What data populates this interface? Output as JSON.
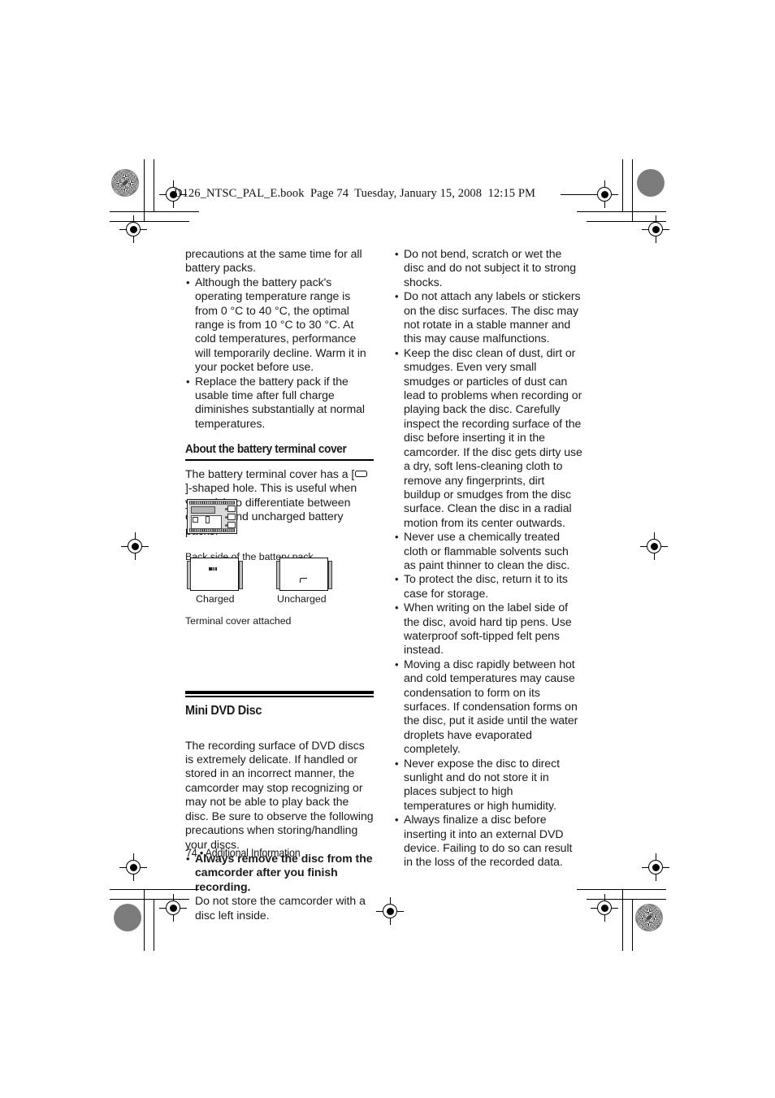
{
  "running_head": "D126_NTSC_PAL_E.book  Page 74  Tuesday, January 15, 2008  12:15 PM",
  "left_column": {
    "continued_paragraph": "precautions at the same time for all battery packs.",
    "battery_bullets": [
      "Although the battery pack's operating temperature range is from 0 °C to 40 °C, the optimal range is from 10 °C to 30 °C. At cold temperatures, performance will temporarily decline. Warm it in your pocket before use.",
      "Replace the battery pack if the usable time after full charge diminishes substantially at normal temperatures."
    ],
    "terminal_cover": {
      "heading": "About the battery terminal cover",
      "text_before_glyph": "The battery terminal cover has a [",
      "text_after_glyph": "]-shaped hole. This is useful when you wish to differentiate between charged and uncharged battery packs.",
      "caption_back_side": "Back side of the battery pack",
      "caption_terminal_cover": "Terminal cover attached",
      "label_charged": "Charged",
      "label_uncharged": "Uncharged"
    },
    "mini_dvd": {
      "heading": "Mini DVD Disc",
      "intro": "The recording surface of DVD discs is extremely delicate. If handled or stored in an incorrect manner, the camcorder may stop recognizing or may not be able to play back the disc. Be sure to observe the following precautions when storing/handling your discs.",
      "bullets": [
        {
          "lead": "Always remove the disc from the camcorder after you finish recording.",
          "sub": "Do not store the camcorder with a disc left inside."
        }
      ]
    }
  },
  "right_column": {
    "disc_bullets": [
      "Do not bend, scratch or wet the disc and do not subject it to strong shocks.",
      "Do not attach any labels or stickers on the disc surfaces. The disc may not rotate in a stable manner and this may cause malfunctions.",
      "Keep the disc clean of dust, dirt or smudges. Even very small smudges or particles of dust can lead to problems when recording or playing back the disc. Carefully inspect the recording surface of the disc before inserting it in the camcorder. If the disc gets dirty use a dry, soft lens-cleaning cloth to remove any fingerprints, dirt buildup or smudges from the disc surface. Clean the disc in a radial motion from its center outwards.",
      "Never use a chemically treated cloth or flammable solvents such as paint thinner to clean the disc.",
      "To protect the disc, return it to its case for storage.",
      "When writing on the label side of the disc, avoid hard tip pens. Use waterproof soft-tipped felt pens instead.",
      "Moving a disc rapidly between hot and cold temperatures may cause condensation to form on its surfaces. If condensation forms on the disc, put it aside until the water droplets have evaporated completely.",
      "Never expose the disc to direct sunlight and do not store it in places subject to high temperatures or high humidity.",
      "Always finalize a disc before inserting it into an external DVD device. Failing to do so can result in the loss of the recorded data."
    ]
  },
  "footer": {
    "text": "74 • Additional Information"
  }
}
